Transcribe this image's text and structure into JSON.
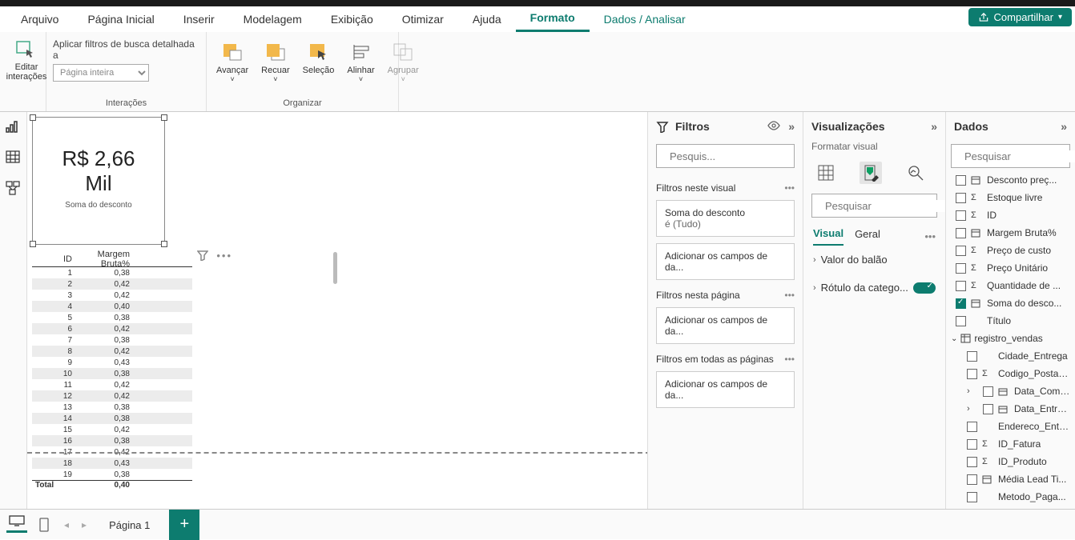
{
  "menu": {
    "tabs": [
      "Arquivo",
      "Página Inicial",
      "Inserir",
      "Modelagem",
      "Exibição",
      "Otimizar",
      "Ajuda",
      "Formato",
      "Dados / Analisar"
    ],
    "active_index": 7,
    "secondary_index": 8,
    "share": "Compartilhar"
  },
  "ribbon": {
    "edit_interactions": "Editar\ninterações",
    "drilldown_label": "Aplicar filtros de busca detalhada a",
    "drilldown_value": "Página inteira",
    "interactions_group": "Interações",
    "arrange": {
      "avancar": "Avançar",
      "recuar": "Recuar",
      "selecao": "Seleção",
      "alinhar": "Alinhar",
      "agrupar": "Agrupar",
      "group": "Organizar"
    }
  },
  "card": {
    "line1": "R$ 2,66",
    "line2": "Mil",
    "caption": "Soma do desconto"
  },
  "table": {
    "col1": "ID",
    "col2": "Margem Bruta%",
    "rows": [
      {
        "id": "1",
        "v": "0,38"
      },
      {
        "id": "2",
        "v": "0,42"
      },
      {
        "id": "3",
        "v": "0,42"
      },
      {
        "id": "4",
        "v": "0,40"
      },
      {
        "id": "5",
        "v": "0,38"
      },
      {
        "id": "6",
        "v": "0,42"
      },
      {
        "id": "7",
        "v": "0,38"
      },
      {
        "id": "8",
        "v": "0,42"
      },
      {
        "id": "9",
        "v": "0,43"
      },
      {
        "id": "10",
        "v": "0,38"
      },
      {
        "id": "11",
        "v": "0,42"
      },
      {
        "id": "12",
        "v": "0,42"
      },
      {
        "id": "13",
        "v": "0,38"
      },
      {
        "id": "14",
        "v": "0,38"
      },
      {
        "id": "15",
        "v": "0,42"
      },
      {
        "id": "16",
        "v": "0,38"
      },
      {
        "id": "17",
        "v": "0,42"
      },
      {
        "id": "18",
        "v": "0,43"
      },
      {
        "id": "19",
        "v": "0,38"
      }
    ],
    "total_label": "Total",
    "total_value": "0,40"
  },
  "filters": {
    "title": "Filtros",
    "search_placeholder": "Pesquis...",
    "on_visual": "Filtros neste visual",
    "filter1_name": "Soma do desconto",
    "filter1_state": "é (Tudo)",
    "add_fields": "Adicionar os campos de da...",
    "on_page": "Filtros nesta página",
    "on_all": "Filtros em todas as páginas"
  },
  "viz": {
    "title": "Visualizações",
    "subtitle": "Formatar visual",
    "search_placeholder": "Pesquisar",
    "tab_visual": "Visual",
    "tab_geral": "Geral",
    "prop1": "Valor do balão",
    "prop2": "Rótulo da catego..."
  },
  "data": {
    "title": "Dados",
    "search_placeholder": "Pesquisar",
    "fields1": [
      {
        "name": "Desconto preç...",
        "icon": "calc",
        "checked": false
      },
      {
        "name": "Estoque livre",
        "icon": "sum",
        "checked": false
      },
      {
        "name": "ID",
        "icon": "sum",
        "checked": false
      },
      {
        "name": "Margem Bruta%",
        "icon": "calc",
        "checked": false
      },
      {
        "name": "Preço de custo",
        "icon": "sum",
        "checked": false
      },
      {
        "name": "Preço Unitário",
        "icon": "sum",
        "checked": false
      },
      {
        "name": "Quantidade de ...",
        "icon": "sum",
        "checked": false
      },
      {
        "name": "Soma do desco...",
        "icon": "calc",
        "checked": true
      },
      {
        "name": "Título",
        "icon": "",
        "checked": false
      }
    ],
    "table2": "registro_vendas",
    "fields2": [
      {
        "name": "Cidade_Entrega",
        "icon": "",
        "checked": false,
        "chev": false
      },
      {
        "name": "Codigo_Postal_...",
        "icon": "sum",
        "checked": false,
        "chev": false
      },
      {
        "name": "Data_Compra",
        "icon": "date",
        "checked": false,
        "chev": true
      },
      {
        "name": "Data_Entrega",
        "icon": "date",
        "checked": false,
        "chev": true
      },
      {
        "name": "Endereco_Entre...",
        "icon": "",
        "checked": false,
        "chev": false
      },
      {
        "name": "ID_Fatura",
        "icon": "sum",
        "checked": false,
        "chev": false
      },
      {
        "name": "ID_Produto",
        "icon": "sum",
        "checked": false,
        "chev": false
      },
      {
        "name": "Média Lead Ti...",
        "icon": "calc",
        "checked": false,
        "chev": false
      },
      {
        "name": "Metodo_Paga...",
        "icon": "",
        "checked": false,
        "chev": false
      }
    ]
  },
  "page": {
    "name": "Página 1"
  }
}
